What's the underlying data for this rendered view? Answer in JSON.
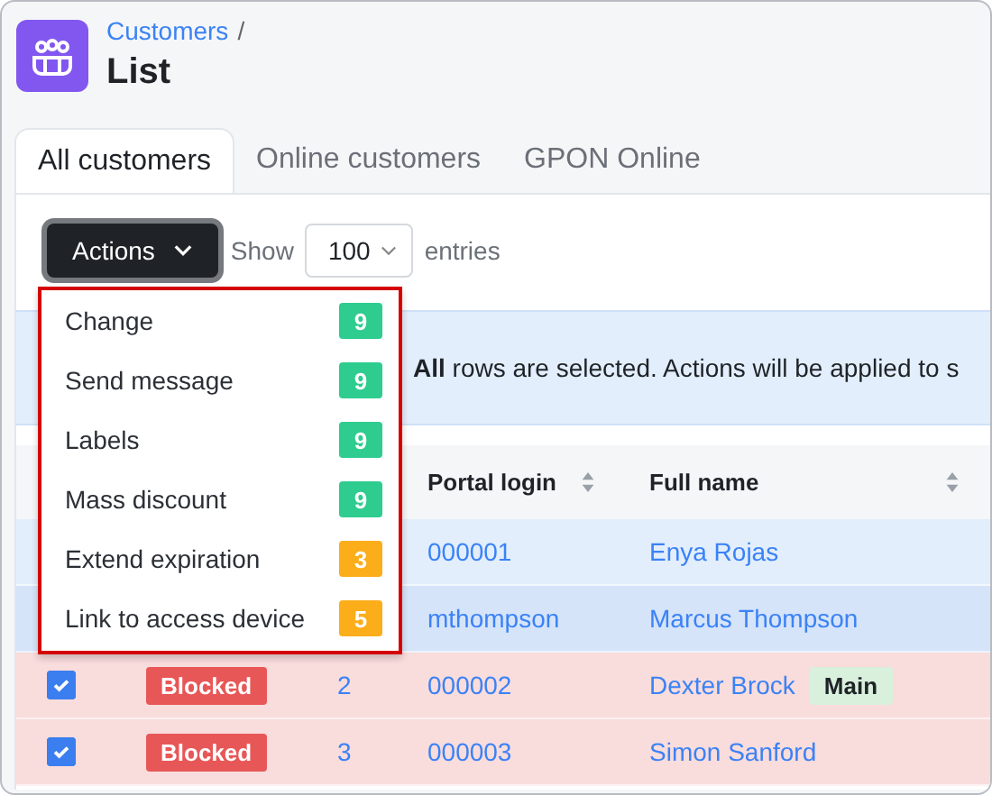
{
  "breadcrumb": {
    "parent": "Customers",
    "separator": "/",
    "title": "List"
  },
  "tabs": [
    {
      "label": "All customers",
      "selected": true
    },
    {
      "label": "Online customers",
      "selected": false
    },
    {
      "label": "GPON Online",
      "selected": false
    }
  ],
  "toolbar": {
    "actions_label": "Actions",
    "show_label": "Show",
    "entries_value": "100",
    "entries_label": "entries"
  },
  "actions_menu": [
    {
      "label": "Change",
      "count": "9",
      "color": "#2ecc8f"
    },
    {
      "label": "Send message",
      "count": "9",
      "color": "#2ecc8f"
    },
    {
      "label": "Labels",
      "count": "9",
      "color": "#2ecc8f"
    },
    {
      "label": "Mass discount",
      "count": "9",
      "color": "#2ecc8f"
    },
    {
      "label": "Extend expiration",
      "count": "3",
      "color": "#fbad1a"
    },
    {
      "label": "Link to access device",
      "count": "5",
      "color": "#fbad1a"
    }
  ],
  "banner": "**All** rows are selected. Actions will be applied to s",
  "table": {
    "columns": [
      "Portal login",
      "Full name"
    ],
    "rows": [
      {
        "kind": "selected",
        "portal_login": "000001",
        "full_name": "Enya Rojas"
      },
      {
        "kind": "hovered",
        "portal_login": "mthompson",
        "full_name": "Marcus Thompson"
      },
      {
        "kind": "blocked",
        "checked": true,
        "status": "Blocked",
        "id": "2",
        "portal_login": "000002",
        "full_name": "Dexter Brock",
        "tag": "Main"
      },
      {
        "kind": "blocked",
        "checked": true,
        "status": "Blocked",
        "id": "3",
        "portal_login": "000003",
        "full_name": "Simon Sanford"
      }
    ]
  }
}
